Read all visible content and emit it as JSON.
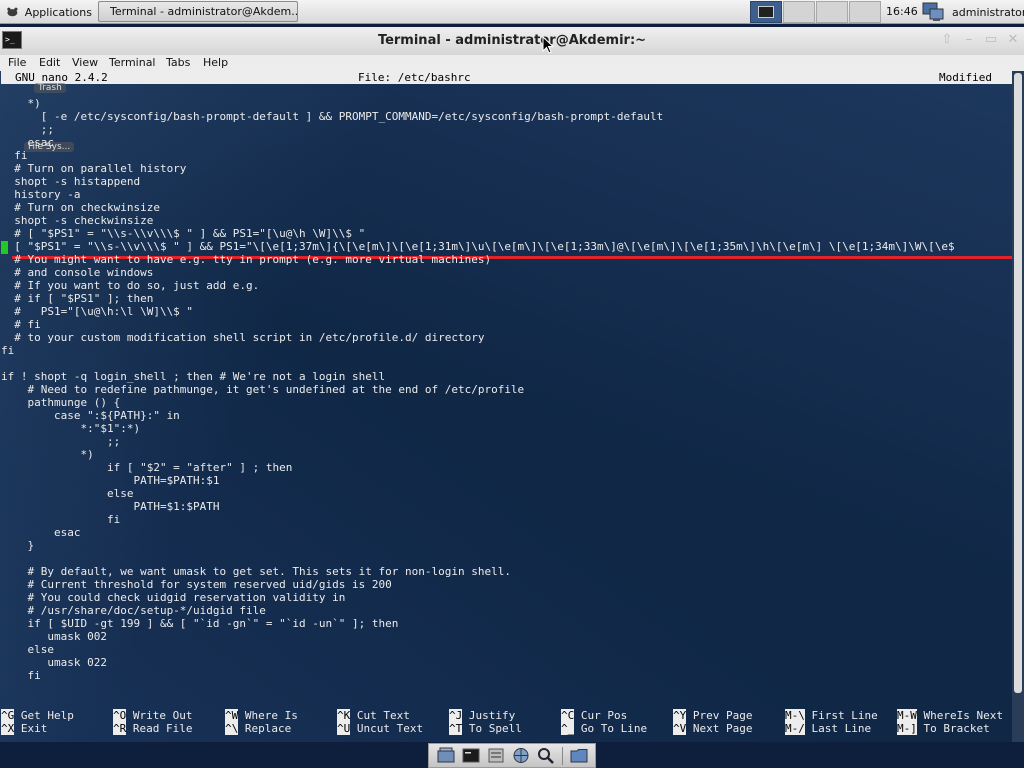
{
  "top_panel": {
    "applications_label": "Applications",
    "task_title": "Terminal - administrator@Akdem...",
    "clock": "16:46",
    "user": "administrator"
  },
  "window": {
    "title": "Terminal - administrator@Akdemir:~",
    "buttons": {
      "up": "⇧",
      "minimize": "–",
      "maximize": "▭",
      "close": "✕"
    }
  },
  "menubar": {
    "items": [
      "File",
      "Edit",
      "View",
      "Terminal",
      "Tabs",
      "Help"
    ]
  },
  "desktop_labels": {
    "trash": "Trash",
    "filesystem": "File Sys..."
  },
  "nano": {
    "version": "GNU nano 2.4.2",
    "file": "File: /etc/bashrc",
    "status": "Modified",
    "lines": [
      "    *)",
      "      [ -e /etc/sysconfig/bash-prompt-default ] && PROMPT_COMMAND=/etc/sysconfig/bash-prompt-default",
      "      ;;",
      "    esac",
      "  fi",
      "  # Turn on parallel history",
      "  shopt -s histappend",
      "  history -a",
      "  # Turn on checkwinsize",
      "  shopt -s checkwinsize",
      "  # [ \"$PS1\" = \"\\\\s-\\\\v\\\\\\$ \" ] && PS1=\"[\\u@\\h \\W]\\\\$ \"",
      "  [ \"$PS1\" = \"\\\\s-\\\\v\\\\\\$ \" ] && PS1=\"\\[\\e[1;37m\\]{\\[\\e[m\\]\\[\\e[1;31m\\]\\u\\[\\e[m\\]\\[\\e[1;33m\\]@\\[\\e[m\\]\\[\\e[1;35m\\]\\h\\[\\e[m\\] \\[\\e[1;34m\\]\\W\\[\\e$",
      "  # You might want to have e.g. tty in prompt (e.g. more virtual machines)",
      "  # and console windows",
      "  # If you want to do so, just add e.g.",
      "  # if [ \"$PS1\" ]; then",
      "  #   PS1=\"[\\u@\\h:\\l \\W]\\\\$ \"",
      "  # fi",
      "  # to your custom modification shell script in /etc/profile.d/ directory",
      "fi",
      "",
      "if ! shopt -q login_shell ; then # We're not a login shell",
      "    # Need to redefine pathmunge, it get's undefined at the end of /etc/profile",
      "    pathmunge () {",
      "        case \":${PATH}:\" in",
      "            *:\"$1\":*)",
      "                ;;",
      "            *)",
      "                if [ \"$2\" = \"after\" ] ; then",
      "                    PATH=$PATH:$1",
      "                else",
      "                    PATH=$1:$PATH",
      "                fi",
      "        esac",
      "    }",
      "",
      "    # By default, we want umask to get set. This sets it for non-login shell.",
      "    # Current threshold for system reserved uid/gids is 200",
      "    # You could check uidgid reservation validity in",
      "    # /usr/share/doc/setup-*/uidgid file",
      "    if [ $UID -gt 199 ] && [ \"`id -gn`\" = \"`id -un`\" ]; then",
      "       umask 002",
      "    else",
      "       umask 022",
      "    fi"
    ],
    "shortcuts": [
      {
        "key": "^G",
        "label": "Get Help"
      },
      {
        "key": "^X",
        "label": "Exit"
      },
      {
        "key": "^O",
        "label": "Write Out"
      },
      {
        "key": "^R",
        "label": "Read File"
      },
      {
        "key": "^W",
        "label": "Where Is"
      },
      {
        "key": "^\\",
        "label": "Replace"
      },
      {
        "key": "^K",
        "label": "Cut Text"
      },
      {
        "key": "^U",
        "label": "Uncut Text"
      },
      {
        "key": "^J",
        "label": "Justify"
      },
      {
        "key": "^T",
        "label": "To Spell"
      },
      {
        "key": "^C",
        "label": "Cur Pos"
      },
      {
        "key": "^_",
        "label": "Go To Line"
      },
      {
        "key": "^Y",
        "label": "Prev Page"
      },
      {
        "key": "^V",
        "label": "Next Page"
      },
      {
        "key": "M-\\",
        "label": "First Line"
      },
      {
        "key": "M-/",
        "label": "Last Line"
      },
      {
        "key": "M-W",
        "label": "WhereIs Next"
      },
      {
        "key": "M-]",
        "label": "To Bracket"
      }
    ]
  },
  "colors": {
    "highlight_line": "#e2242a",
    "cursor": "#22c922",
    "terminal_bg": "#102746"
  }
}
